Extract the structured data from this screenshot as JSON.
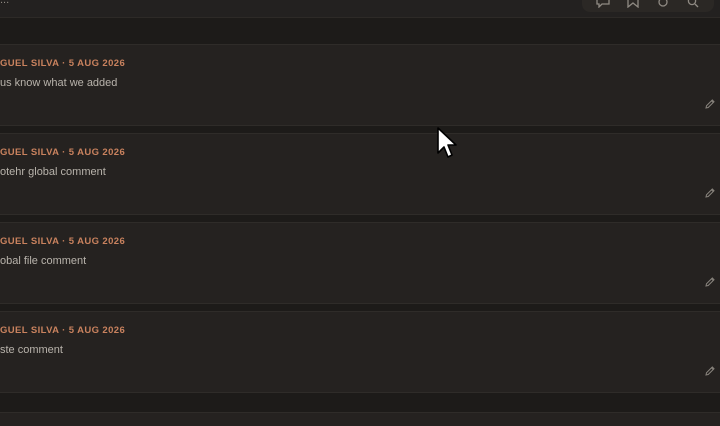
{
  "header": {
    "fragment": "..."
  },
  "toolbar": {
    "icons": [
      "comment-icon",
      "bookmark-icon",
      "settings-icon",
      "search-icon"
    ]
  },
  "comments": [
    {
      "meta": "GUEL SILVA · 5 AUG 2026",
      "text": "us know what we added"
    },
    {
      "meta": "GUEL SILVA · 5 AUG 2026",
      "text": "otehr global comment"
    },
    {
      "meta": "GUEL SILVA · 5 AUG 2026",
      "text": "obal file comment"
    },
    {
      "meta": "GUEL SILVA · 5 AUG 2026",
      "text": "ste comment"
    }
  ]
}
